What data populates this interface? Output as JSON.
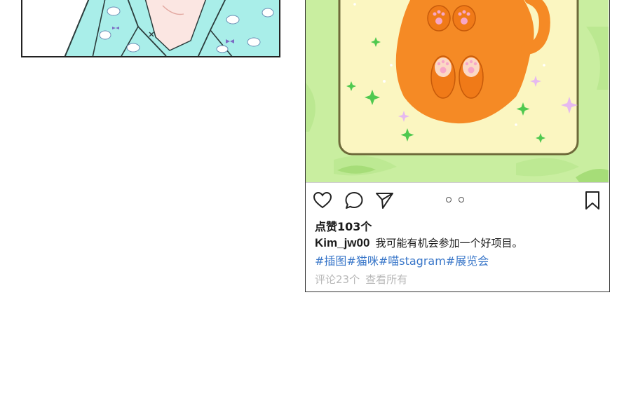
{
  "post": {
    "likes_text": "点赞103个",
    "username": "Kim_jw00",
    "caption_text": "我可能有机会参加一个好项目。",
    "hashtags": [
      "#插图",
      "#猫咪",
      "#喵stagram",
      "#展览会"
    ],
    "comments_count_text": "评论23个",
    "view_all_text": "查看所有",
    "carousel_page_count": 2
  },
  "icons": {
    "like": "heart-icon",
    "comment": "comment-icon",
    "share": "send-icon",
    "save": "bookmark-icon"
  },
  "colors": {
    "hashtag": "#3a77c9",
    "meta_text": "#b8b8b8",
    "image_green": "#c9eea0",
    "mat_yellow": "#fbf6c1",
    "cat_orange": "#f58a25",
    "left_panel_teal": "#a9eee9"
  }
}
